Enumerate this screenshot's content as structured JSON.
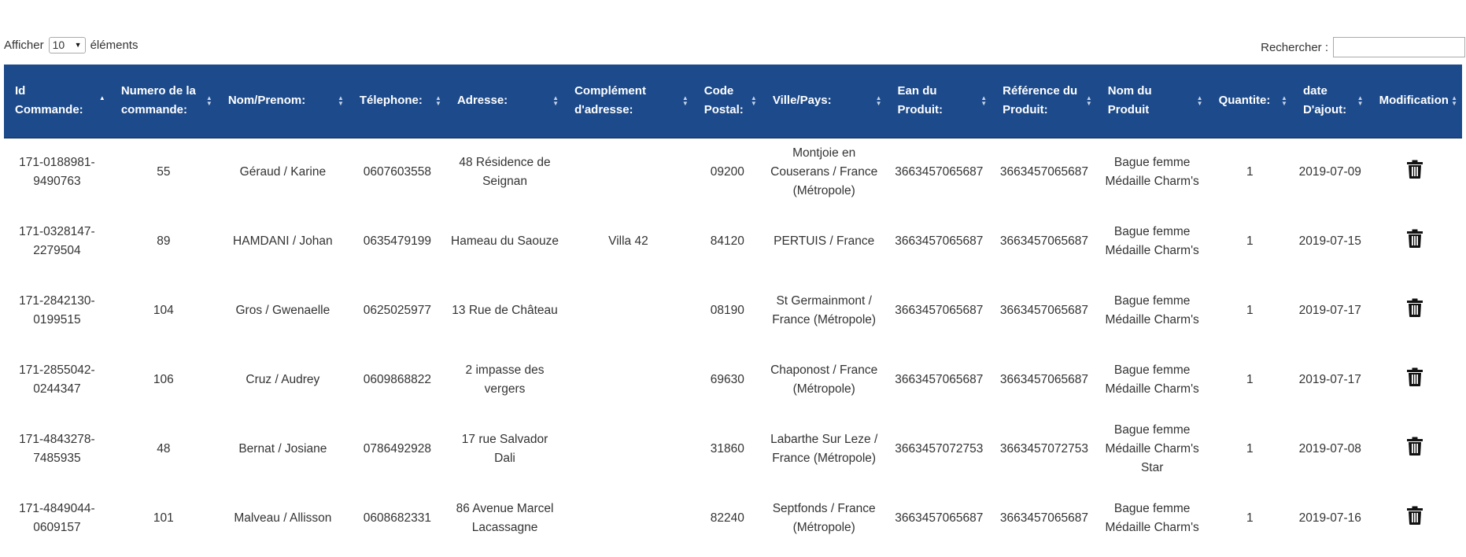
{
  "length_control": {
    "prefix": "Afficher",
    "selected": "10",
    "suffix": "éléments"
  },
  "search": {
    "label": "Rechercher :",
    "value": ""
  },
  "table": {
    "columns": [
      "Id Commande:",
      "Numero de la commande:",
      "Nom/Prenom:",
      "Télephone:",
      "Adresse:",
      "Complément d'adresse:",
      "Code Postal:",
      "Ville/Pays:",
      "Ean du Produit:",
      "Référence du Produit:",
      "Nom du Produit",
      "Quantite:",
      "date D'ajout:",
      "Modification"
    ],
    "rows": [
      [
        "171-0188981-9490763",
        "55",
        "Géraud / Karine",
        "0607603558",
        "48 Résidence de Seignan",
        "",
        "09200",
        "Montjoie en Couserans / France (Métropole)",
        "3663457065687",
        "3663457065687",
        "Bague femme Médaille Charm's",
        "1",
        "2019-07-09"
      ],
      [
        "171-0328147-2279504",
        "89",
        "HAMDANI / Johan",
        "0635479199",
        "Hameau du Saouze",
        "Villa 42",
        "84120",
        "PERTUIS / France",
        "3663457065687",
        "3663457065687",
        "Bague femme Médaille Charm's",
        "1",
        "2019-07-15"
      ],
      [
        "171-2842130-0199515",
        "104",
        "Gros / Gwenaelle",
        "0625025977",
        "13 Rue de Château",
        "",
        "08190",
        "St Germainmont / France (Métropole)",
        "3663457065687",
        "3663457065687",
        "Bague femme Médaille Charm's",
        "1",
        "2019-07-17"
      ],
      [
        "171-2855042-0244347",
        "106",
        "Cruz / Audrey",
        "0609868822",
        "2 impasse des vergers",
        "",
        "69630",
        "Chaponost / France (Métropole)",
        "3663457065687",
        "3663457065687",
        "Bague femme Médaille Charm's",
        "1",
        "2019-07-17"
      ],
      [
        "171-4843278-7485935",
        "48",
        "Bernat / Josiane",
        "0786492928",
        "17 rue Salvador Dali",
        "",
        "31860",
        "Labarthe Sur Leze / France (Métropole)",
        "3663457072753",
        "3663457072753",
        "Bague femme Médaille Charm's Star",
        "1",
        "2019-07-08"
      ],
      [
        "171-4849044-0609157",
        "101",
        "Malveau / Allisson",
        "0608682331",
        "86 Avenue Marcel Lacassagne",
        "",
        "82240",
        "Septfonds / France (Métropole)",
        "3663457065687",
        "3663457065687",
        "Bague femme Médaille Charm's",
        "1",
        "2019-07-16"
      ]
    ],
    "action_icon": "trash-icon",
    "sorted_column": 0
  },
  "colors": {
    "header_bg": "#1c4a8b",
    "header_text": "#ffffff",
    "body_text": "#333333"
  }
}
